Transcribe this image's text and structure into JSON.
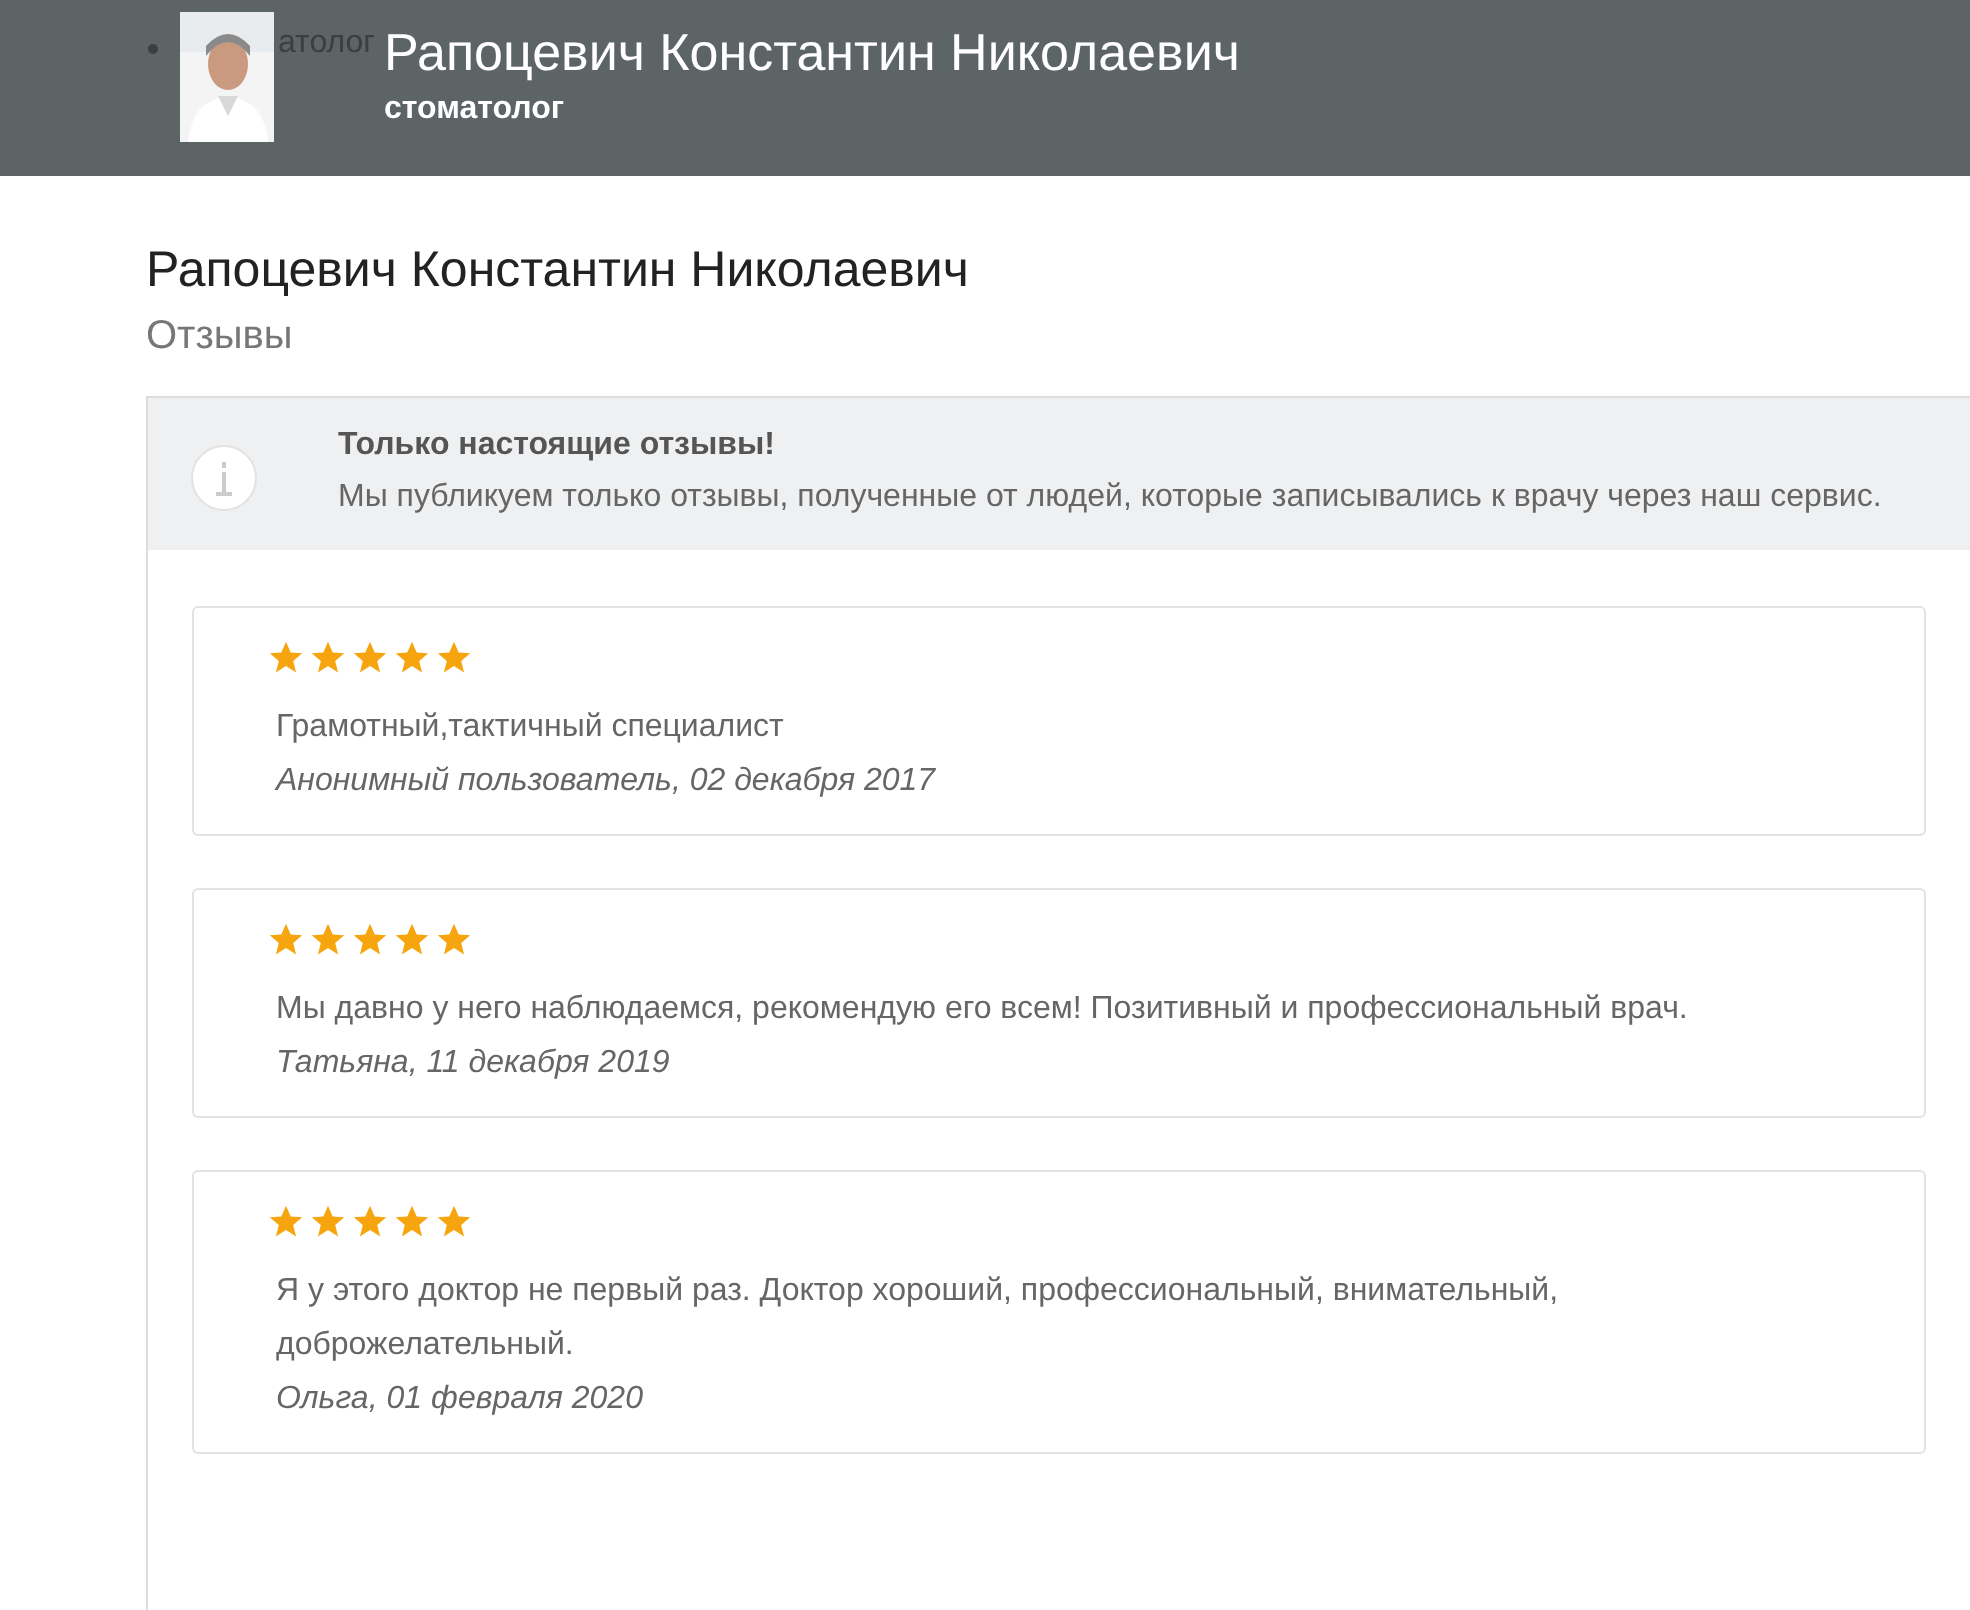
{
  "header": {
    "bullet_text": "атолог",
    "name": "Рапоцевич Константин Николаевич",
    "specialty": "стоматолог"
  },
  "page": {
    "title": "Рапоцевич Константин Николаевич",
    "subtitle": "Отзывы"
  },
  "notice": {
    "title": "Только настоящие отзывы!",
    "text": "Мы публикуем только отзывы, полученные от людей, которые записывались к врачу через наш сервис."
  },
  "reviews": [
    {
      "stars": 5,
      "text": "Грамотный,тактичный специалист",
      "author": "Анонимный пользователь, 02 декабря 2017"
    },
    {
      "stars": 5,
      "text": "Мы давно у него наблюдаемся, рекомендую его всем! Позитивный и профессиональный врач.",
      "author": "Татьяна, 11 декабря 2019"
    },
    {
      "stars": 5,
      "text": "Я у этого доктор не первый раз. Доктор хороший, профессиональный, внимательный, доброжелательный.",
      "author": "Ольга, 01 февраля 2020"
    }
  ]
}
